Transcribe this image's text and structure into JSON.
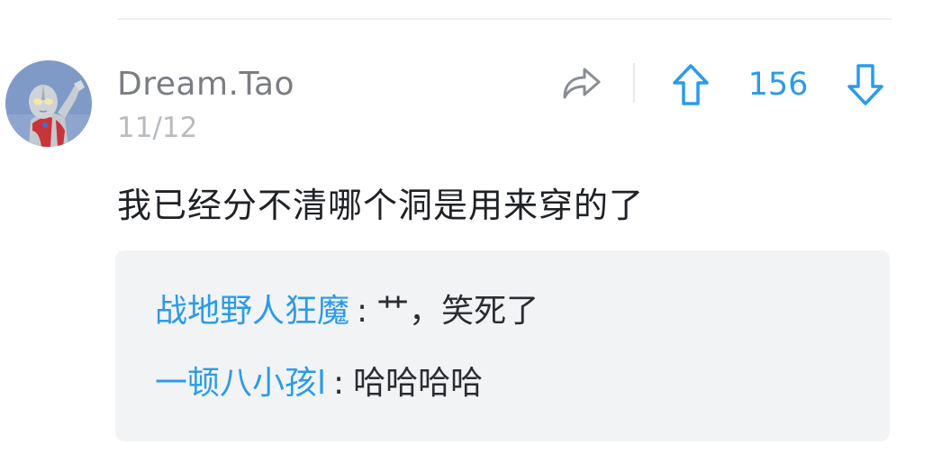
{
  "comment": {
    "username": "Dream.Tao",
    "date": "11/12",
    "vote_count": "156",
    "text": "我已经分不清哪个洞是用来穿的了",
    "avatar_icon": "ultraman-avatar",
    "share_icon": "share-arrow-icon",
    "upvote_icon": "arrow-up-icon",
    "downvote_icon": "arrow-down-icon"
  },
  "replies": [
    {
      "author": "战地野人狂魔",
      "separator": ":",
      "text": "艹，笑死了"
    },
    {
      "author": "一顿八小孩l",
      "separator": ":",
      "text": "哈哈哈哈"
    }
  ],
  "colors": {
    "accent": "#2b9be8",
    "username": "#7b7d84",
    "date": "#b8bbc1",
    "text": "#1f2126",
    "reply_bg": "#f2f3f5"
  }
}
